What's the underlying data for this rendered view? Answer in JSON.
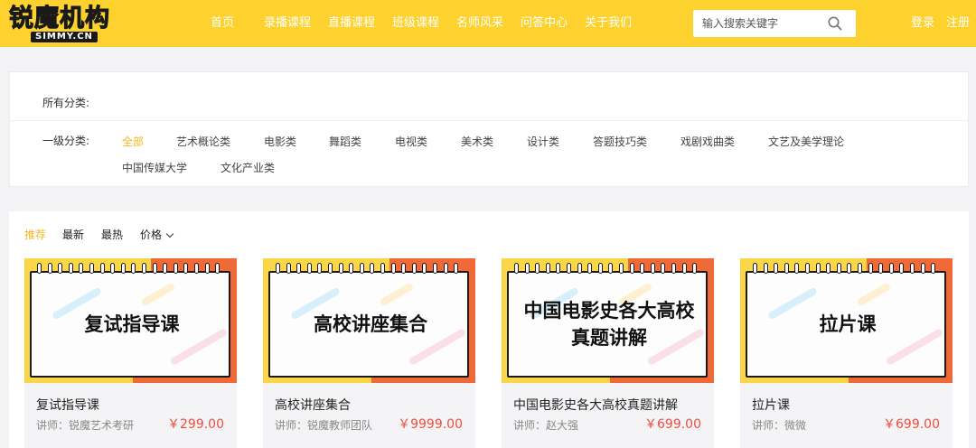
{
  "brand": {
    "name": "锐魔机构",
    "sub": "SIMMY.CN"
  },
  "nav": [
    "首页",
    "录播课程",
    "直播课程",
    "班级课程",
    "名师风采",
    "问答中心",
    "关于我们"
  ],
  "search": {
    "placeholder": "输入搜索关键字",
    "icon": "search-icon"
  },
  "auth": {
    "login": "登录",
    "register": "注册"
  },
  "filter": {
    "all_label": "所有分类:",
    "level1_label": "一级分类:",
    "categories": [
      "全部",
      "艺术概论类",
      "电影类",
      "舞蹈类",
      "电视类",
      "美术类",
      "设计类",
      "答题技巧类",
      "戏剧戏曲类",
      "文艺及美学理论",
      "中国传媒大学",
      "文化产业类"
    ],
    "active_category": "全部"
  },
  "sort": {
    "items": [
      "推荐",
      "最新",
      "最热",
      "价格"
    ],
    "active": "推荐",
    "dropdown_icon": "chevron-down-icon"
  },
  "courses": [
    {
      "thumb_lines": [
        "复试指导课"
      ],
      "title": "复试指导课",
      "teacher": "讲师：锐魔艺术考研",
      "price": "￥299.00"
    },
    {
      "thumb_lines": [
        "高校讲座集合"
      ],
      "title": "高校讲座集合",
      "teacher": "讲师：锐魔教师团队",
      "price": "￥9999.00"
    },
    {
      "thumb_lines": [
        "中国电影史各大高校",
        "真题讲解"
      ],
      "title": "中国电影史各大高校真题讲解",
      "teacher": "讲师：赵大强",
      "price": "￥699.00"
    },
    {
      "thumb_lines": [
        "拉片课"
      ],
      "title": "拉片课",
      "teacher": "讲师：微微",
      "price": "￥699.00"
    }
  ],
  "colors": {
    "brand_yellow": "#fdd22e",
    "accent_orange": "#f5b722",
    "price_red": "#f04c3e",
    "thumb_orange": "#f06a37"
  }
}
